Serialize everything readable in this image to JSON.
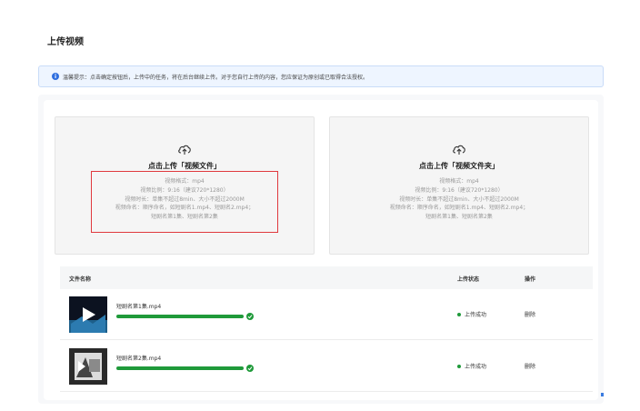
{
  "page": {
    "title": "上传视频"
  },
  "notice": {
    "text": "温馨提示：点击确定按钮后，上传中的任务，将在后台继续上传。对于您自行上传的内容，您应保证为原创或已取得合法授权。"
  },
  "upload_file": {
    "title": "点击上传「视频文件」",
    "specs": [
      "视频格式：mp4",
      "视频比例：9:16（建议720*1280）",
      "视频时长：单集不超过8min、大小不超过2000M",
      "视频命名：顺序命名，如短剧名1.mp4、短剧名2.mp4；",
      "短剧名第1集、短剧名第2集"
    ]
  },
  "upload_folder": {
    "title": "点击上传「视频文件夹」",
    "specs": [
      "视频格式：mp4",
      "视频比例：9:16（建议720*1280）",
      "视频时长：单集不超过8min、大小不超过2000M",
      "视频命名：顺序命名，如短剧名1.mp4、短剧名2.mp4；",
      "短剧名第1集、短剧名第2集"
    ]
  },
  "table": {
    "headers": {
      "name": "文件名称",
      "status": "上传状态",
      "action": "操作"
    },
    "rows": [
      {
        "filename": "短剧名第1集.mp4",
        "progress": 1.0,
        "status": "上传成功",
        "action": "删除"
      },
      {
        "filename": "短剧名第2集.mp4",
        "progress": 1.0,
        "status": "上传成功",
        "action": "删除"
      }
    ]
  },
  "colors": {
    "success": "#1f9a3a",
    "highlight": "#e0393e",
    "accent": "#2f6fdf"
  },
  "icons": {
    "notice": "info-icon",
    "upload": "cloud-upload-icon",
    "done": "check-circle-icon"
  }
}
